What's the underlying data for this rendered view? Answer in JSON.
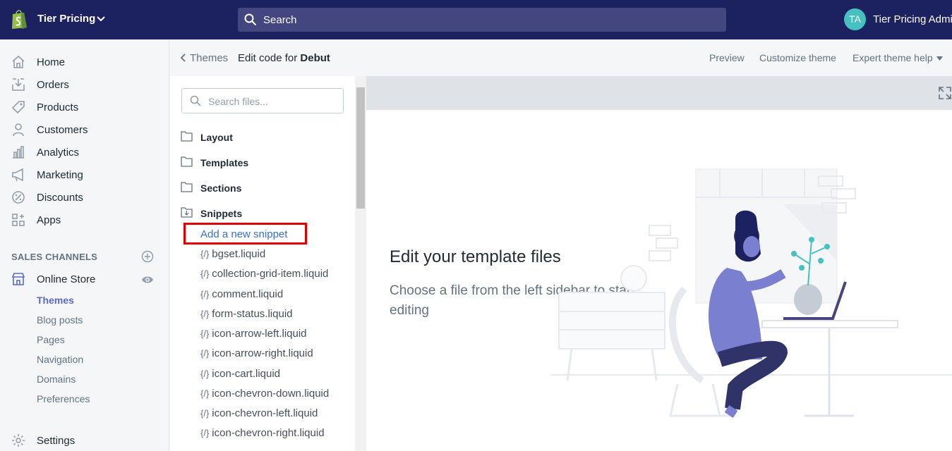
{
  "topbar": {
    "store_name": "Tier Pricing",
    "search_label": "Search",
    "avatar_initials": "TA",
    "admin_name": "Tier Pricing Admin"
  },
  "sidebar": {
    "items": [
      {
        "label": "Home",
        "icon": "home-icon"
      },
      {
        "label": "Orders",
        "icon": "orders-icon"
      },
      {
        "label": "Products",
        "icon": "tag-icon"
      },
      {
        "label": "Customers",
        "icon": "person-icon"
      },
      {
        "label": "Analytics",
        "icon": "analytics-icon"
      },
      {
        "label": "Marketing",
        "icon": "megaphone-icon"
      },
      {
        "label": "Discounts",
        "icon": "discount-icon"
      },
      {
        "label": "Apps",
        "icon": "apps-icon"
      }
    ],
    "sales_channels_title": "SALES CHANNELS",
    "online_store": "Online Store",
    "online_store_sub": [
      "Themes",
      "Blog posts",
      "Pages",
      "Navigation",
      "Domains",
      "Preferences"
    ],
    "settings": "Settings"
  },
  "header": {
    "breadcrumb": "Themes",
    "title_prefix": "Edit code for",
    "title_theme": "Debut",
    "actions": [
      "Preview",
      "Customize theme",
      "Expert theme help"
    ]
  },
  "file_panel": {
    "search_placeholder": "Search files...",
    "folders": [
      "Layout",
      "Templates",
      "Sections",
      "Snippets"
    ],
    "add_snippet": "Add a new snippet",
    "file_icon_text": "{/}",
    "files": [
      "bgset.liquid",
      "collection-grid-item.liquid",
      "comment.liquid",
      "form-status.liquid",
      "icon-arrow-left.liquid",
      "icon-arrow-right.liquid",
      "icon-cart.liquid",
      "icon-chevron-down.liquid",
      "icon-chevron-left.liquid",
      "icon-chevron-right.liquid"
    ]
  },
  "editor": {
    "empty_title": "Edit your template files",
    "empty_desc": "Choose a file from the left sidebar to start editing"
  },
  "colors": {
    "topbar": "#1c2260",
    "accent": "#5c6ac4",
    "link": "#3a6fc4",
    "highlight": "#e00000"
  }
}
